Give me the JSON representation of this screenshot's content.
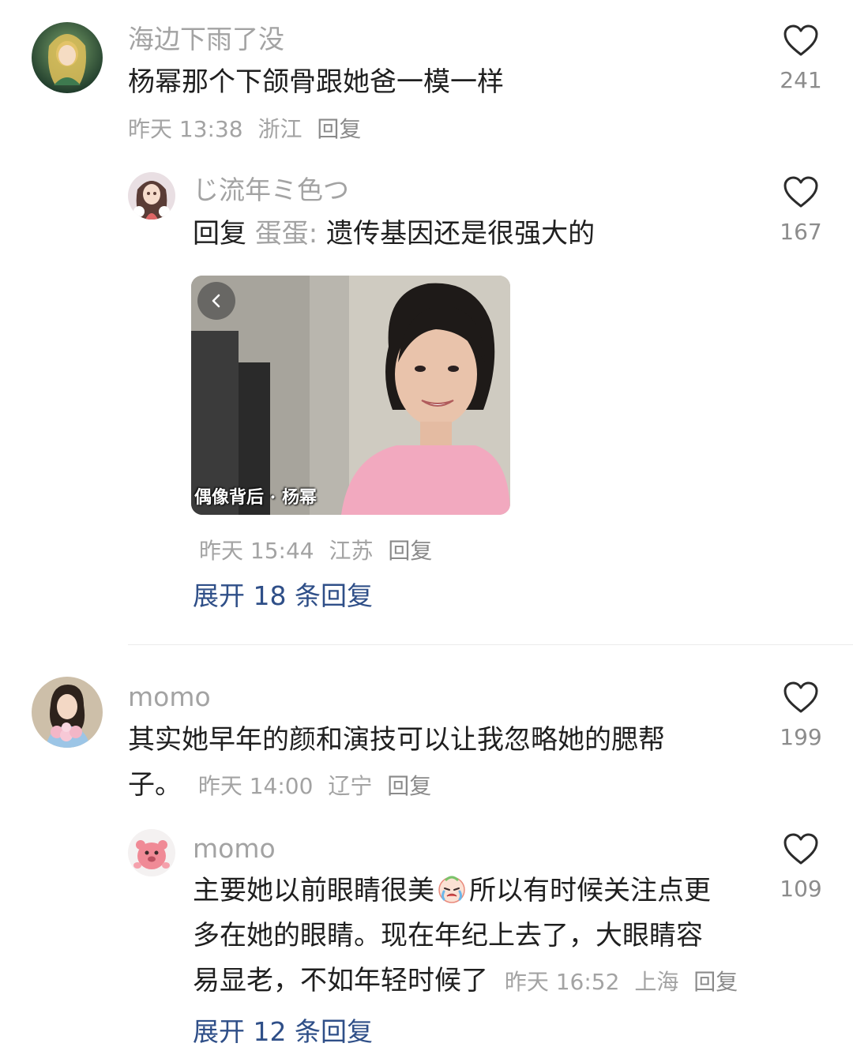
{
  "comments": [
    {
      "username": "海边下雨了没",
      "text": "杨幂那个下颌骨跟她爸一模一样",
      "time": "昨天 13:38",
      "location": "浙江",
      "reply_label": "回复",
      "likes": "241",
      "reply": {
        "username": "じ流年ミ色つ",
        "reply_prefix": "回复",
        "mention": "蛋蛋:",
        "text": "遗传基因还是很强大的",
        "likes": "167",
        "image_caption": "偶像背后 · 杨幂",
        "time": "昨天 15:44",
        "location": "江苏",
        "reply_label": "回复"
      },
      "expand_label": "展开 18 条回复"
    },
    {
      "username": "momo",
      "text_line1": "其实她早年的颜和演技可以让我忽略她的腮帮",
      "text_line2": "子。",
      "time": "昨天 14:00",
      "location": "辽宁",
      "reply_label": "回复",
      "likes": "199",
      "reply": {
        "username": "momo",
        "text_part1": "主要她以前眼睛很美",
        "emoji": "crying-face-emoji",
        "text_part2": "所以有时候关注点更",
        "text_line2": "多在她的眼睛。现在年纪上去了，大眼睛容",
        "text_line3": "易显老，不如年轻时候了",
        "time": "昨天 16:52",
        "location": "上海",
        "reply_label": "回复",
        "likes": "109"
      },
      "expand_label": "展开 12 条回复"
    }
  ],
  "colors": {
    "text": "#1f1f1f",
    "secondary": "#a3a3a3",
    "link": "#2f4f88"
  }
}
